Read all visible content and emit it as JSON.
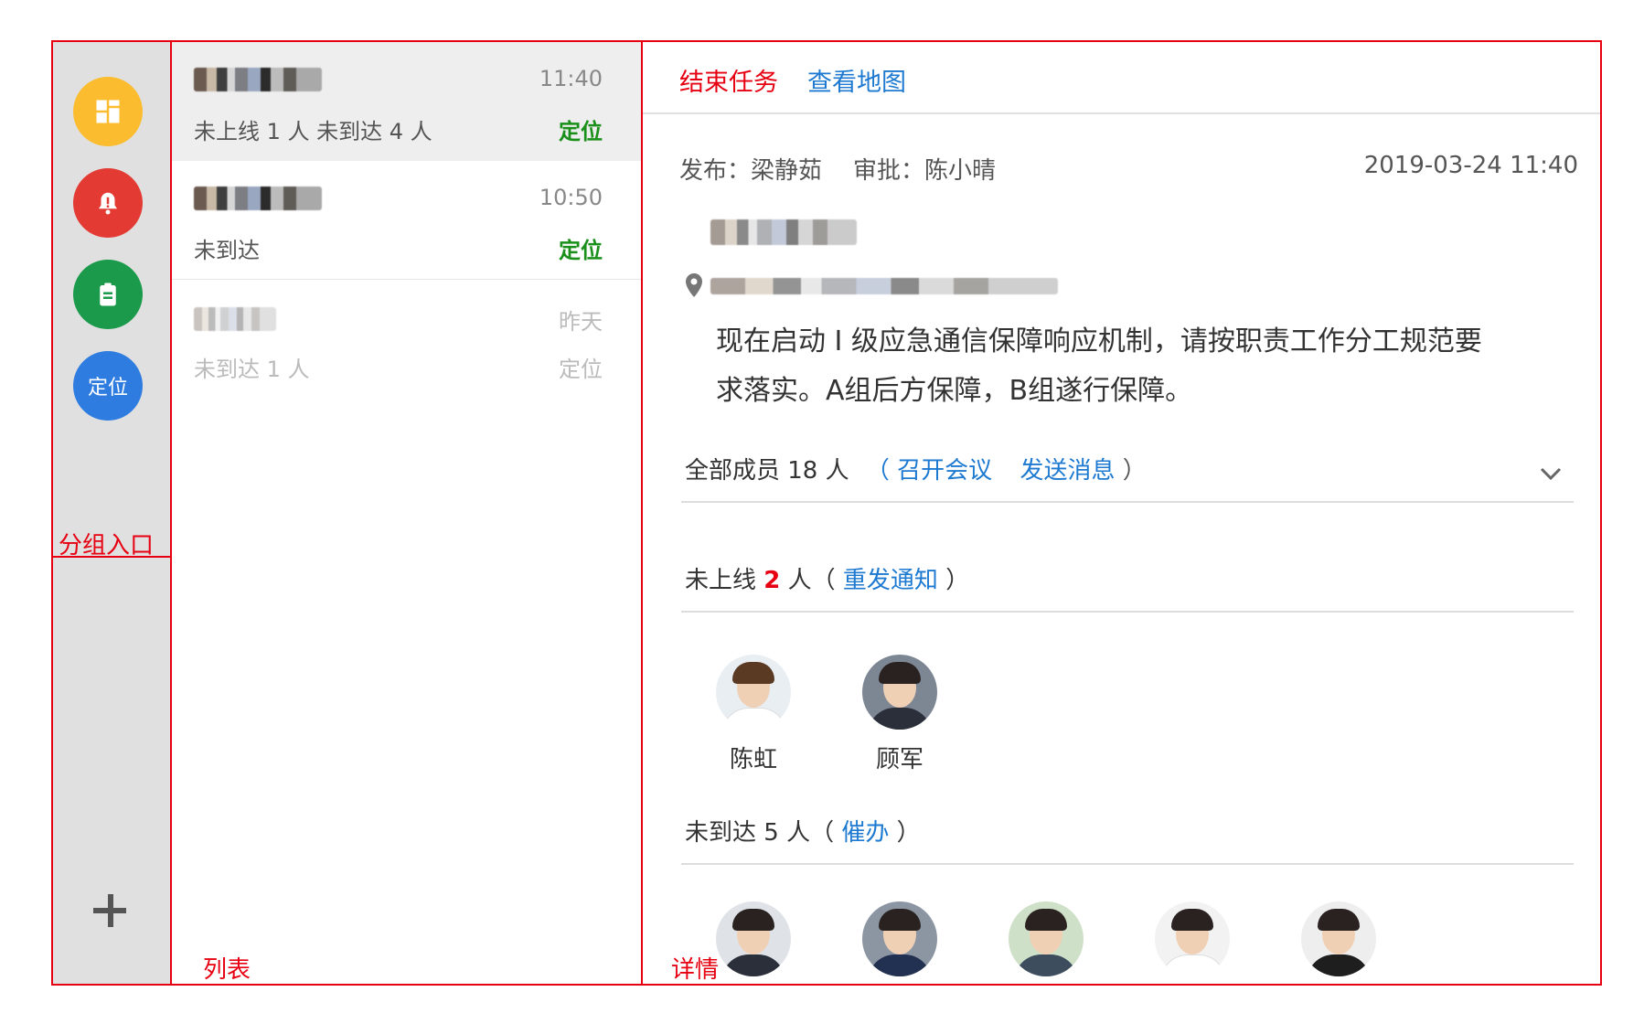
{
  "sidebar": {
    "items": [
      {
        "name": "dashboard",
        "icon": "grid-icon",
        "color": "#fbbd2f"
      },
      {
        "name": "alarm",
        "icon": "alarm-bell-icon",
        "color": "#e33b33"
      },
      {
        "name": "task",
        "icon": "clipboard-icon",
        "color": "#1a9a4a"
      },
      {
        "name": "location",
        "label": "定位",
        "color": "#2f7ce0"
      }
    ],
    "add_icon": "plus-icon",
    "annotation": "分组入口"
  },
  "list": {
    "annotation": "列表",
    "items": [
      {
        "time": "11:40",
        "sub": "未上线 1 人   未到达 4 人",
        "action": "定位"
      },
      {
        "time": "10:50",
        "sub": "未到达",
        "action": "定位"
      },
      {
        "time": "昨天",
        "sub": "未到达 1 人",
        "action": "定位"
      }
    ]
  },
  "detail": {
    "annotation": "详情",
    "actions": {
      "end_task": "结束任务",
      "view_map": "查看地图"
    },
    "meta": {
      "publisher": "发布：梁静茹",
      "approver": "审批：陈小晴",
      "datetime": "2019-03-24 11:40"
    },
    "location_icon": "map-pin-icon",
    "message_line1": "现在启动 I 级应急通信保障响应机制，请按职责工作分工规范要",
    "message_line2": "求落实。A组后方保障，B组遂行保障。",
    "members": {
      "label": "全部成员 18 人",
      "paren_open": "（",
      "meeting": "召开会议",
      "send_message": "发送消息",
      "paren_close": "）",
      "expand_icon": "chevron-down-icon"
    },
    "offline": {
      "prefix": "未上线",
      "count": "2",
      "unit": "人（",
      "resend": "重发通知",
      "close": "）",
      "people": [
        "陈虹",
        "顾军"
      ]
    },
    "not_arrived": {
      "label": "未到达 5 人（",
      "urge": "催办",
      "close": "）"
    }
  }
}
